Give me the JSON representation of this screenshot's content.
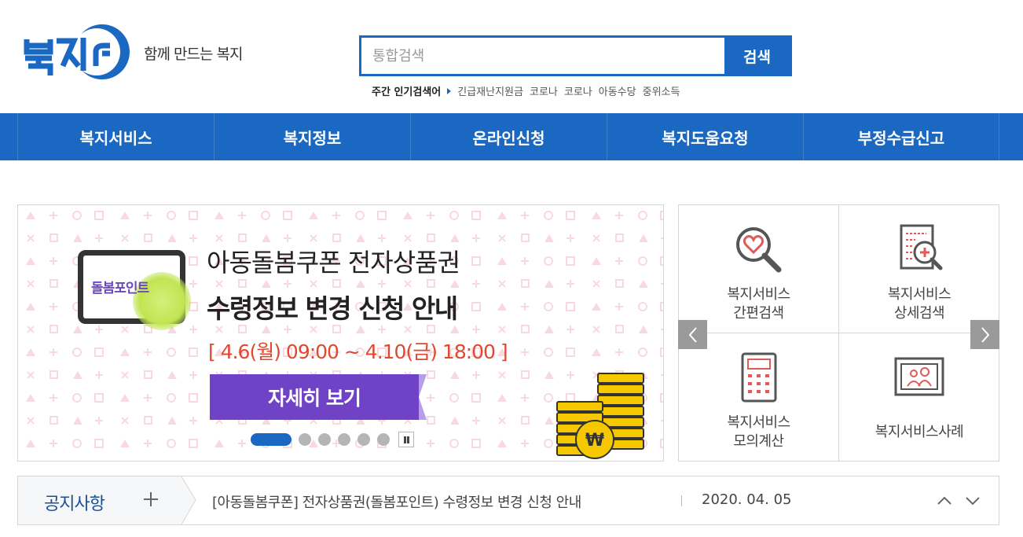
{
  "header": {
    "logo_text": "복지ro",
    "tagline": "함께 만드는 복지",
    "search": {
      "placeholder": "통합검색",
      "value": "",
      "button_label": "검색"
    },
    "popular": {
      "title": "주간 인기검색어",
      "keywords": [
        "긴급재난지원금",
        "코로나",
        "코로나",
        "아동수당",
        "중위소득"
      ]
    }
  },
  "nav": {
    "items": [
      "복지서비스",
      "복지정보",
      "온라인신청",
      "복지도움요청",
      "부정수급신고"
    ]
  },
  "banner": {
    "coupon_label": "돌봄포인트",
    "title_line1": "아동돌봄쿠폰 전자상품권",
    "title_line2": "수령정보 변경 신청 안내",
    "date_range": "[ 4.6(월) 09:00 ~ 4.10(금) 18:00 ]",
    "cta_label": "자세히 보기",
    "slide_count": 6,
    "active_slide": 1
  },
  "quick": {
    "items": [
      {
        "label": "복지서비스\n간편검색",
        "icon": "heart-magnifier-icon"
      },
      {
        "label": "복지서비스\n상세검색",
        "icon": "document-search-icon"
      },
      {
        "label": "복지서비스\n모의계산",
        "icon": "calculator-icon"
      },
      {
        "label": "복지서비스사례",
        "icon": "family-picture-icon"
      }
    ]
  },
  "notice": {
    "title": "공지사항",
    "text": "[아동돌봄쿠폰] 전자상품권(돌봄포인트) 수령정보 변경 신청 안내",
    "date": "2020. 04. 05"
  },
  "colors": {
    "primary": "#1a68c2",
    "cta_purple": "#7043c6",
    "date_red": "#e2482d",
    "icon_red": "#e05a5a"
  }
}
